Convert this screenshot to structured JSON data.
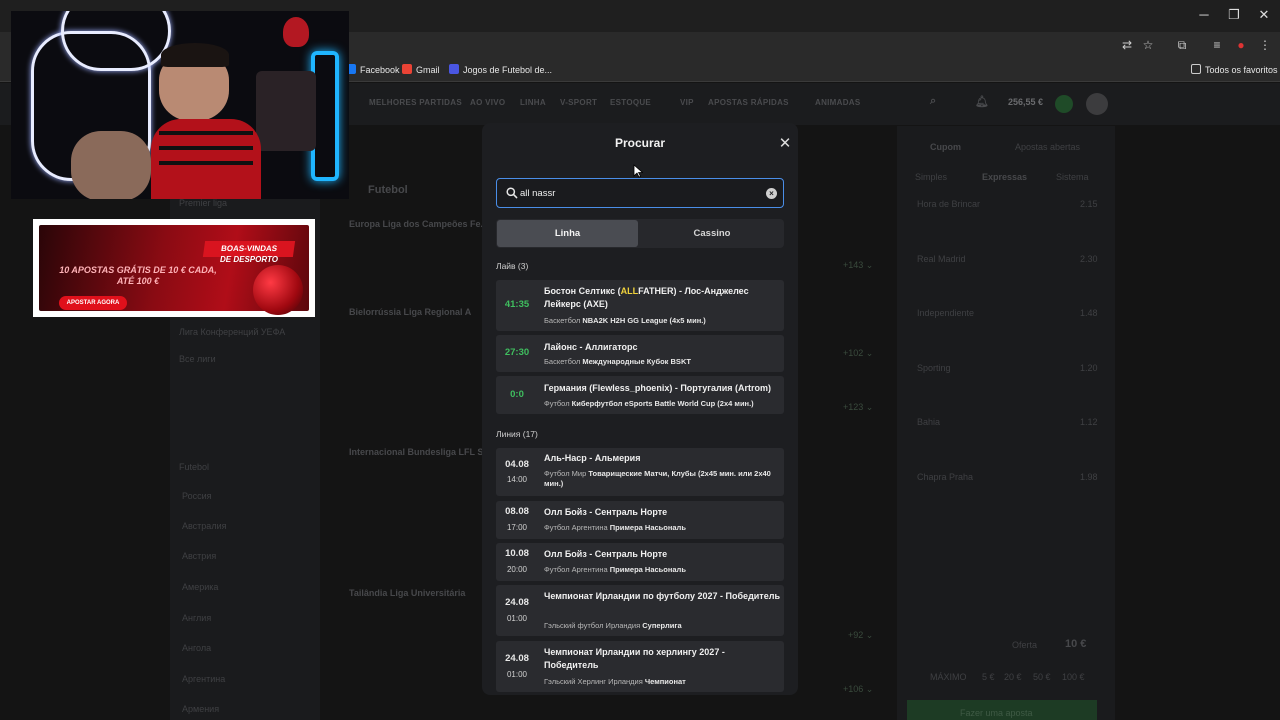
{
  "browser": {
    "bookmarks": [
      {
        "label": "Facebook",
        "color": "#1877f2"
      },
      {
        "label": "Gmail",
        "color": "#ea4335"
      },
      {
        "label": "Jogos de Futebol de...",
        "color": "#4a56e2"
      }
    ],
    "all_favorites": "Todos os favoritos"
  },
  "site": {
    "nav": [
      "MELHORES PARTIDAS",
      "AO VIVO",
      "LINHA",
      "V-SPORT",
      "ESTOQUE",
      "VIP",
      "APOSTAS RÁPIDAS",
      "ANIMADAS"
    ],
    "balance": "256,55 €"
  },
  "background": {
    "section": "Futebol",
    "leagues": [
      "Europa Liga dos Campeões Fe...",
      "Bielorrússia Liga Regional A",
      "Internacional Bundesliga LFL S...",
      "Tailândia Liga Universitária"
    ],
    "left_labels": [
      "Premier liga",
      "Лига Конференций УЕФА",
      "Все лиги",
      "Futebol",
      "Россия",
      "Австралия",
      "Австрия",
      "Америка",
      "Англия",
      "Ангола",
      "Аргентина",
      "Армения"
    ],
    "betslip_tabs": [
      "Cupom",
      "Apostas abertas"
    ],
    "betslip_types": [
      "Simples",
      "Expressas",
      "Sistema"
    ],
    "betslip_odds": [
      "2.15",
      "2.30",
      "1.48",
      "1.20",
      "1.12",
      "1.98"
    ],
    "betslip_entries": [
      "Hora de Brincar",
      "Real Madrid",
      "Independiente",
      "Sporting",
      "Bahia",
      "Chapra Praha"
    ],
    "stake_label": "Oferta",
    "stake_value": "10 €",
    "max_label": "MÁXIMO",
    "chips": [
      "5 €",
      "20 €",
      "50 €",
      "100 €"
    ],
    "place_bet": "Fazer uma aposta"
  },
  "ad": {
    "title1": "BOAS-VINDAS",
    "title2": "DE DESPORTO",
    "main": "10 APOSTAS GRÁTIS DE 10 € CADA, ATÉ 100 €",
    "button": "APOSTAR AGORA"
  },
  "search_modal": {
    "title": "Procurar",
    "query": "all nassr",
    "tabs": {
      "active": "Linha",
      "inactive": "Cassino"
    },
    "live_header": "Лайв (3)",
    "live": [
      {
        "time": "41:35",
        "title_pre": "Бостон Селтикс (",
        "title_hl": "ALL",
        "title_post": "FATHER) - Лос-Анджелес Лейкерс (AXE)",
        "sport": "Баскетбол",
        "league": "NBA2K H2H GG League (4x5 мин.)"
      },
      {
        "time": "27:30",
        "title": "Лайонс - Аллигаторс",
        "sport": "Баскетбол",
        "league": "Международные Кубок BSKT"
      },
      {
        "time": "0:0",
        "title": "Германия (Flewless_phoenix) - Португалия (Artrom)",
        "sport": "Футбол",
        "league": "Киберфутбол eSports Battle World Cup (2x4 мин.)"
      }
    ],
    "line_header": "Линия (17)",
    "line": [
      {
        "date": "04.08",
        "hour": "14:00",
        "title": "Аль-Наср - Альмерия",
        "sport": "Футбол",
        "country": "Мир",
        "league": "Товарищеские Матчи, Клубы (2x45 мин. или 2x40 мин.)"
      },
      {
        "date": "08.08",
        "hour": "17:00",
        "title": "Олл Бойз - Сентраль Норте",
        "sport": "Футбол",
        "country": "Аргентина",
        "league": "Примера Насьональ"
      },
      {
        "date": "10.08",
        "hour": "20:00",
        "title": "Олл Бойз - Сентраль Норте",
        "sport": "Футбол",
        "country": "Аргентина",
        "league": "Примера Насьональ"
      },
      {
        "date": "24.08",
        "hour": "01:00",
        "title": "Чемпионат Ирландии по футболу 2027 - Победитель",
        "sport": "Гэльский футбол",
        "country": "Ирландия",
        "league": "Суперлига"
      },
      {
        "date": "24.08",
        "hour": "01:00",
        "title": "Чемпионат Ирландии по херлингу 2027 - Победитель",
        "sport": "Гэльский Херлинг",
        "country": "Ирландия",
        "league": "Чемпионат"
      }
    ]
  }
}
